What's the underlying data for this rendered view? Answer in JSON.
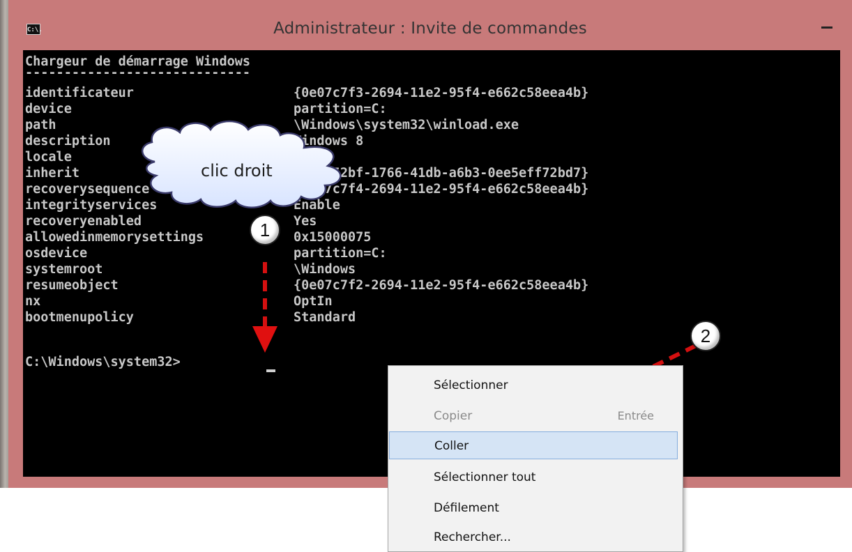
{
  "window": {
    "title": "Administrateur : Invite de commandes",
    "icon": "cmd-icon",
    "icon_text": "C:\\."
  },
  "console": {
    "header": "Chargeur de démarrage Windows",
    "separator": "-----------------------------",
    "rows": [
      {
        "key": "identificateur",
        "value": "{0e07c7f3-2694-11e2-95f4-e662c58eea4b}"
      },
      {
        "key": "device",
        "value": "partition=C:"
      },
      {
        "key": "path",
        "value": "\\Windows\\system32\\winload.exe"
      },
      {
        "key": "description",
        "value": "Windows 8"
      },
      {
        "key": "locale",
        "value": ""
      },
      {
        "key": "inherit",
        "value": "{6efb52bf-1766-41db-a6b3-0ee5eff72bd7}"
      },
      {
        "key": "recoverysequence",
        "value": "{0e07c7f4-2694-11e2-95f4-e662c58eea4b}"
      },
      {
        "key": "integrityservices",
        "value": "Enable"
      },
      {
        "key": "recoveryenabled",
        "value": "Yes"
      },
      {
        "key": "allowedinmemorysettings",
        "value": "0x15000075"
      },
      {
        "key": "osdevice",
        "value": "partition=C:"
      },
      {
        "key": "systemroot",
        "value": "\\Windows"
      },
      {
        "key": "resumeobject",
        "value": "{0e07c7f2-2694-11e2-95f4-e662c58eea4b}"
      },
      {
        "key": "nx",
        "value": "OptIn"
      },
      {
        "key": "bootmenupolicy",
        "value": "Standard"
      }
    ],
    "prompt": "C:\\Windows\\system32>"
  },
  "annotations": {
    "cloud_label": "clic droit",
    "badge_1": "1",
    "badge_2": "2"
  },
  "context_menu": {
    "items": [
      {
        "label": "Sélectionner",
        "enabled": true
      },
      {
        "label": "Copier",
        "shortcut": "Entrée",
        "enabled": false
      },
      {
        "label": "Coller",
        "enabled": true,
        "highlighted": true
      },
      {
        "label": "Sélectionner tout",
        "enabled": true
      },
      {
        "label": "Défilement",
        "enabled": true
      },
      {
        "label": "Rechercher...",
        "enabled": true
      }
    ]
  },
  "colors": {
    "window_frame": "#c87a7a",
    "console_bg": "#000000",
    "console_text": "#c8c8c8",
    "menu_highlight": "#d5e4f5",
    "arrow_red": "#e01010"
  }
}
